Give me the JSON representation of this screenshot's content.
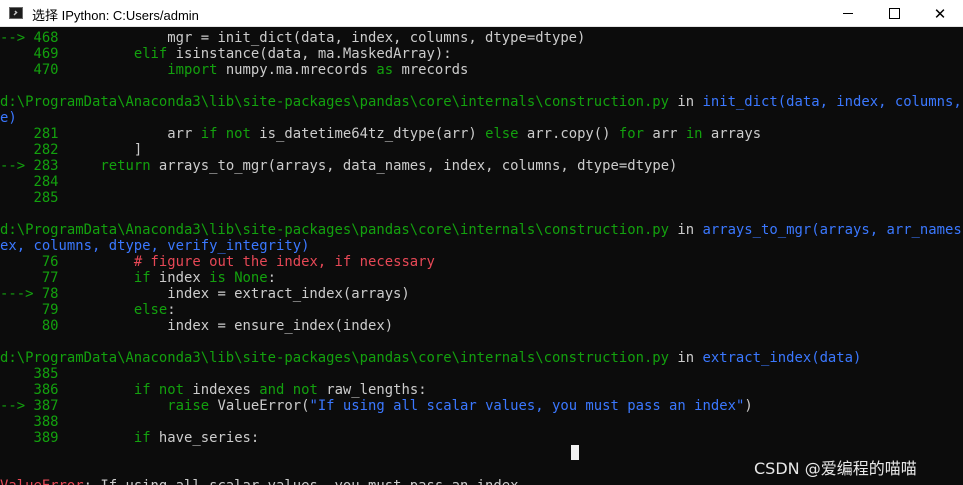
{
  "window": {
    "title": "选择 IPython: C:Users/admin",
    "controls": {
      "minimize": "—",
      "maximize": "□",
      "close": "✕"
    }
  },
  "terminal": {
    "lines": [
      {
        "segments": [
          {
            "c": "g",
            "t": "--> 468"
          },
          {
            "c": "w",
            "t": "             mgr = init_dict(data, index, columns, dtype=dtype)"
          }
        ]
      },
      {
        "segments": [
          {
            "c": "g",
            "t": "    469"
          },
          {
            "c": "w",
            "t": "         "
          },
          {
            "c": "g",
            "t": "elif"
          },
          {
            "c": "w",
            "t": " isinstance(data, ma.MaskedArray):"
          }
        ]
      },
      {
        "segments": [
          {
            "c": "g",
            "t": "    470"
          },
          {
            "c": "w",
            "t": "             "
          },
          {
            "c": "g",
            "t": "import"
          },
          {
            "c": "w",
            "t": " numpy.ma.mrecords "
          },
          {
            "c": "g",
            "t": "as"
          },
          {
            "c": "w",
            "t": " mrecords"
          }
        ]
      },
      {
        "segments": []
      },
      {
        "segments": [
          {
            "c": "g",
            "t": "d:\\ProgramData\\Anaconda3\\lib\\site-packages\\pandas\\core\\internals\\construction.py"
          },
          {
            "c": "w",
            "t": " in "
          },
          {
            "c": "b",
            "t": "init_dict(data, index, columns, dtype"
          }
        ]
      },
      {
        "segments": [
          {
            "c": "b",
            "t": "e)"
          }
        ]
      },
      {
        "segments": [
          {
            "c": "g",
            "t": "    281"
          },
          {
            "c": "w",
            "t": "             arr "
          },
          {
            "c": "g",
            "t": "if not"
          },
          {
            "c": "w",
            "t": " is_datetime64tz_dtype(arr) "
          },
          {
            "c": "g",
            "t": "else"
          },
          {
            "c": "w",
            "t": " arr.copy() "
          },
          {
            "c": "g",
            "t": "for"
          },
          {
            "c": "w",
            "t": " arr "
          },
          {
            "c": "g",
            "t": "in"
          },
          {
            "c": "w",
            "t": " arrays"
          }
        ]
      },
      {
        "segments": [
          {
            "c": "g",
            "t": "    282"
          },
          {
            "c": "w",
            "t": "         ]"
          }
        ]
      },
      {
        "segments": [
          {
            "c": "g",
            "t": "--> 283"
          },
          {
            "c": "w",
            "t": "     "
          },
          {
            "c": "g",
            "t": "return"
          },
          {
            "c": "w",
            "t": " arrays_to_mgr(arrays, data_names, index, columns, dtype=dtype)"
          }
        ]
      },
      {
        "segments": [
          {
            "c": "g",
            "t": "    284"
          }
        ]
      },
      {
        "segments": [
          {
            "c": "g",
            "t": "    285"
          }
        ]
      },
      {
        "segments": []
      },
      {
        "segments": [
          {
            "c": "g",
            "t": "d:\\ProgramData\\Anaconda3\\lib\\site-packages\\pandas\\core\\internals\\construction.py"
          },
          {
            "c": "w",
            "t": " in "
          },
          {
            "c": "b",
            "t": "arrays_to_mgr(arrays, arr_names, ind"
          }
        ]
      },
      {
        "segments": [
          {
            "c": "b",
            "t": "ex, columns, dtype, verify_integrity)"
          }
        ]
      },
      {
        "segments": [
          {
            "c": "g",
            "t": "     76"
          },
          {
            "c": "w",
            "t": "         "
          },
          {
            "c": "r",
            "t": "# figure out the index, if necessary"
          }
        ]
      },
      {
        "segments": [
          {
            "c": "g",
            "t": "     77"
          },
          {
            "c": "w",
            "t": "         "
          },
          {
            "c": "g",
            "t": "if"
          },
          {
            "c": "w",
            "t": " index "
          },
          {
            "c": "g",
            "t": "is None"
          },
          {
            "c": "w",
            "t": ":"
          }
        ]
      },
      {
        "segments": [
          {
            "c": "g",
            "t": "---> 78"
          },
          {
            "c": "w",
            "t": "             index = extract_index(arrays)"
          }
        ]
      },
      {
        "segments": [
          {
            "c": "g",
            "t": "     79"
          },
          {
            "c": "w",
            "t": "         "
          },
          {
            "c": "g",
            "t": "else"
          },
          {
            "c": "w",
            "t": ":"
          }
        ]
      },
      {
        "segments": [
          {
            "c": "g",
            "t": "     80"
          },
          {
            "c": "w",
            "t": "             index = ensure_index(index)"
          }
        ]
      },
      {
        "segments": []
      },
      {
        "segments": [
          {
            "c": "g",
            "t": "d:\\ProgramData\\Anaconda3\\lib\\site-packages\\pandas\\core\\internals\\construction.py"
          },
          {
            "c": "w",
            "t": " in "
          },
          {
            "c": "b",
            "t": "extract_index(data)"
          }
        ]
      },
      {
        "segments": [
          {
            "c": "g",
            "t": "    385"
          }
        ]
      },
      {
        "segments": [
          {
            "c": "g",
            "t": "    386"
          },
          {
            "c": "w",
            "t": "         "
          },
          {
            "c": "g",
            "t": "if not"
          },
          {
            "c": "w",
            "t": " indexes "
          },
          {
            "c": "g",
            "t": "and not"
          },
          {
            "c": "w",
            "t": " raw_lengths:"
          }
        ]
      },
      {
        "segments": [
          {
            "c": "g",
            "t": "--> 387"
          },
          {
            "c": "w",
            "t": "             "
          },
          {
            "c": "g",
            "t": "raise"
          },
          {
            "c": "w",
            "t": " ValueError("
          },
          {
            "c": "b",
            "t": "\"If using all scalar values, you must pass an index\""
          },
          {
            "c": "w",
            "t": ")"
          }
        ]
      },
      {
        "segments": [
          {
            "c": "g",
            "t": "    388"
          }
        ]
      },
      {
        "segments": [
          {
            "c": "g",
            "t": "    389"
          },
          {
            "c": "w",
            "t": "         "
          },
          {
            "c": "g",
            "t": "if"
          },
          {
            "c": "w",
            "t": " have_series:"
          }
        ]
      },
      {
        "segments": []
      },
      {
        "segments": []
      },
      {
        "segments": [
          {
            "c": "r",
            "t": "ValueError"
          },
          {
            "c": "w",
            "t": ": If using all scalar values, you must pass an index"
          }
        ]
      }
    ]
  },
  "watermark": "CSDN @爱编程的喵喵",
  "colors": {
    "background": "#0c0c0c",
    "text": "#cccccc",
    "green": "#13a10e",
    "blue": "#3b78ff",
    "red": "#e74856"
  }
}
